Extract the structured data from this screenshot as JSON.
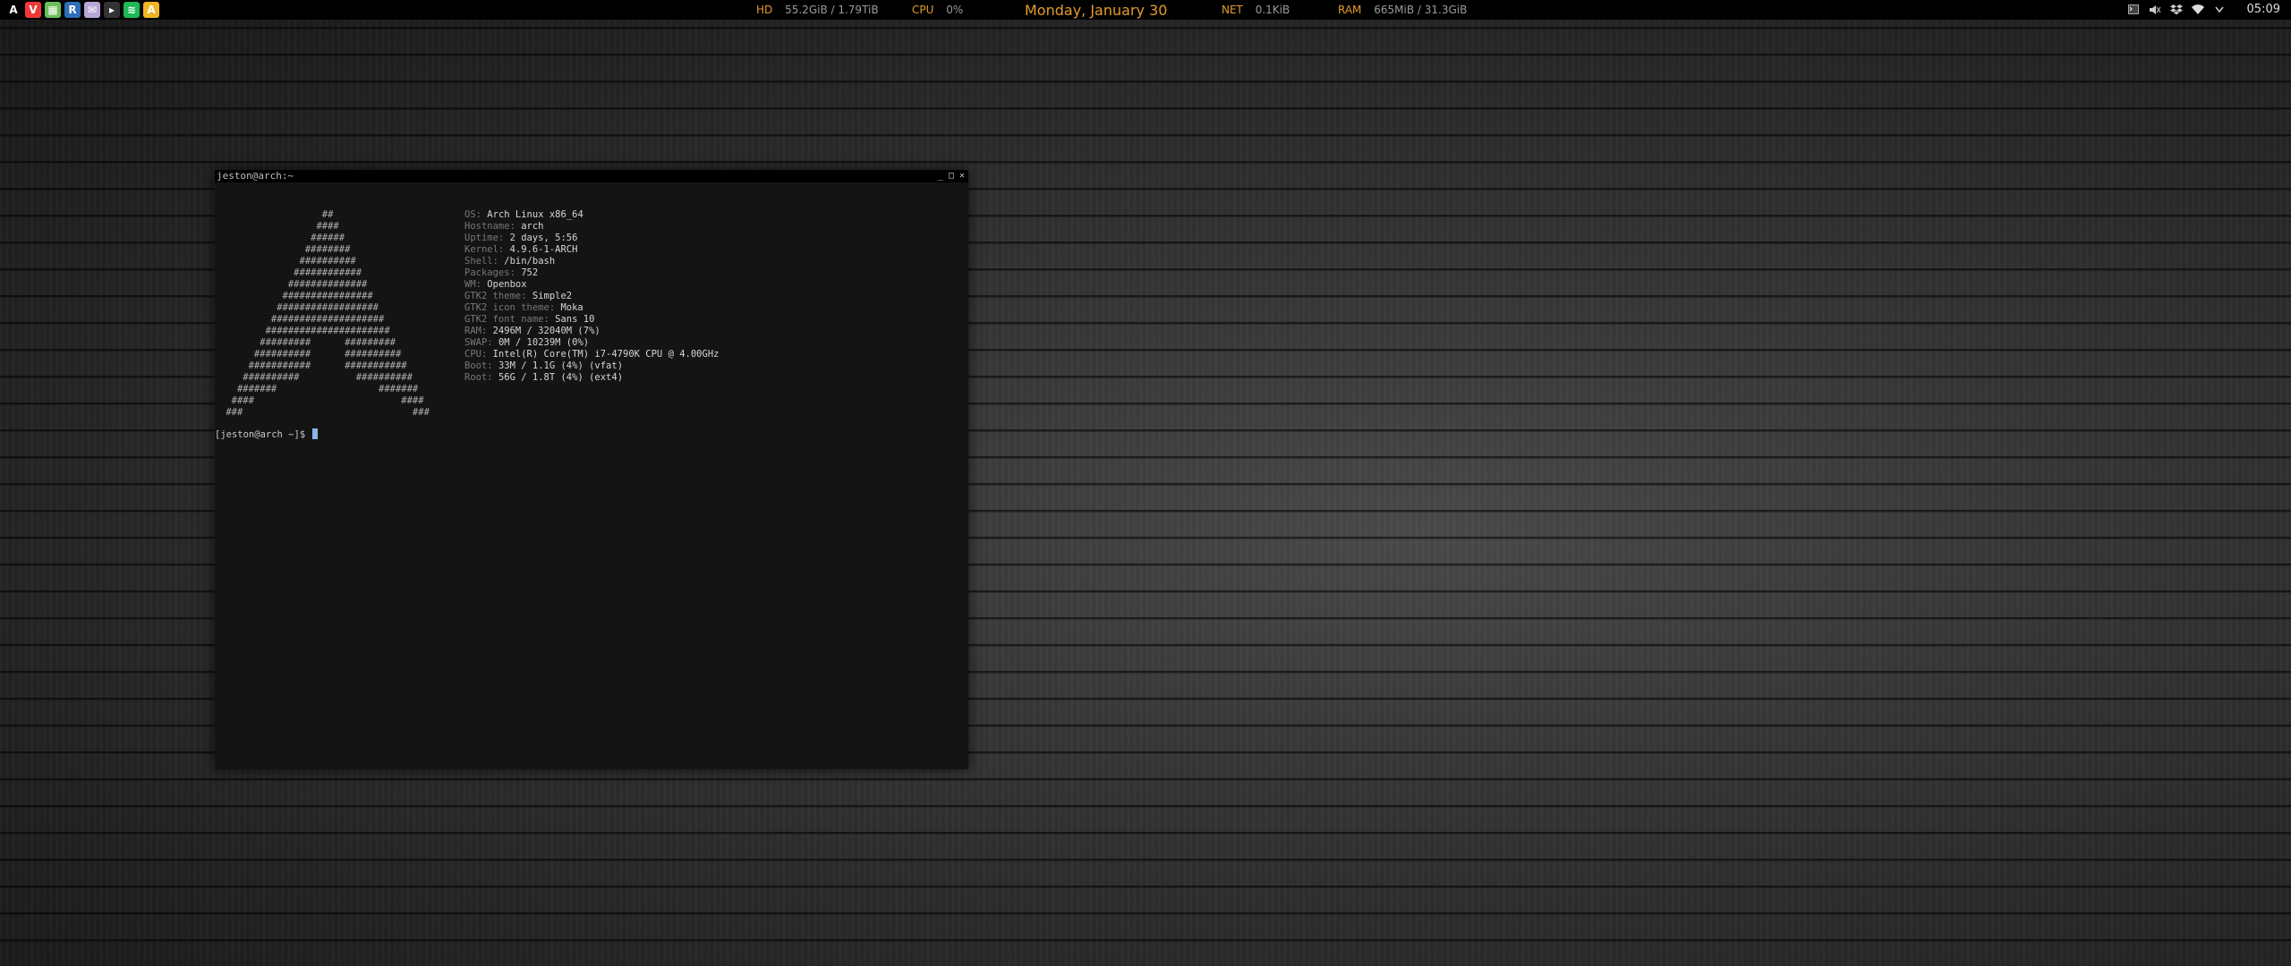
{
  "topbar": {
    "launchers": [
      {
        "icon": "arch-icon",
        "glyph": "A",
        "color": "#000000"
      },
      {
        "icon": "vivaldi-icon",
        "glyph": "V",
        "color": "#ef3939"
      },
      {
        "icon": "image-viewer-icon",
        "glyph": "▦",
        "color": "#6bbf59"
      },
      {
        "icon": "r-icon",
        "glyph": "R",
        "color": "#2e6fb7"
      },
      {
        "icon": "mail-icon",
        "glyph": "✉",
        "color": "#b9a6d6"
      },
      {
        "icon": "terminal-icon",
        "glyph": "▸",
        "color": "#333333"
      },
      {
        "icon": "spotify-icon",
        "glyph": "≋",
        "color": "#1db954"
      },
      {
        "icon": "font-icon",
        "glyph": "A",
        "color": "#f1b520"
      }
    ],
    "hd": {
      "label": "HD",
      "value": "55.2GiB / 1.79TiB"
    },
    "cpu": {
      "label": "CPU",
      "value": "0%"
    },
    "date": "Monday, January 30",
    "net": {
      "label": "NET",
      "value": "0.1KiB"
    },
    "ram": {
      "label": "RAM",
      "value": "665MiB / 31.3GiB"
    },
    "clock": "05:09",
    "accent": "#e39b2b"
  },
  "terminal": {
    "title": "jeston@arch:~",
    "buttons": {
      "minimize": "_",
      "maximize": "□",
      "close": "✕"
    },
    "ascii_art": "                  ##\n                 ####\n                ######\n               ########\n              ##########\n             ############\n            ##############\n           ################\n          ##################\n         ####################\n        ######################\n       #########      #########\n      ##########      ##########\n     ###########      ###########\n    ##########          ##########\n   #######                  #######\n  ####                          ####\n ###                              ###",
    "info": [
      {
        "key": "OS: ",
        "value": "Arch Linux x86_64"
      },
      {
        "key": "Hostname: ",
        "value": "arch"
      },
      {
        "key": "Uptime: ",
        "value": "2 days, 5:56"
      },
      {
        "key": "Kernel: ",
        "value": "4.9.6-1-ARCH"
      },
      {
        "key": "Shell: ",
        "value": "/bin/bash"
      },
      {
        "key": "Packages: ",
        "value": "752"
      },
      {
        "key": "WM: ",
        "value": "Openbox"
      },
      {
        "key": "GTK2 theme: ",
        "value": "Simple2"
      },
      {
        "key": "GTK2 icon theme: ",
        "value": "Moka"
      },
      {
        "key": "GTK2 font name: ",
        "value": "Sans 10"
      },
      {
        "key": "RAM: ",
        "value": "2496M / 32040M (7%)"
      },
      {
        "key": "SWAP: ",
        "value": "0M / 10239M (0%)"
      },
      {
        "key": "CPU: ",
        "value": "Intel(R) Core(TM) i7-4790K CPU @ 4.00GHz"
      },
      {
        "key": "Boot: ",
        "value": "33M / 1.1G (4%) (vfat)"
      },
      {
        "key": "Root: ",
        "value": "56G / 1.8T (4%) (ext4)"
      }
    ],
    "prompt": "[jeston@arch ~]$ "
  }
}
